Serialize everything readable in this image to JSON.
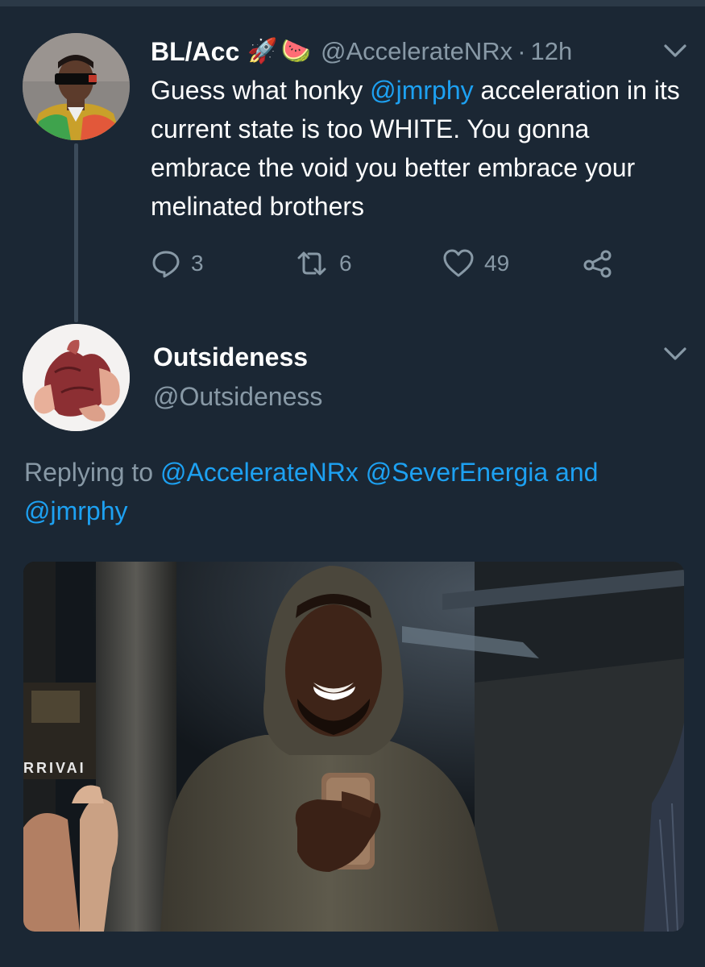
{
  "tweet": {
    "display_name": "BL/Acc",
    "emojis": [
      "🚀",
      "🍉"
    ],
    "handle": "@AccelerateNRx",
    "separator": "·",
    "time": "12h",
    "text_segments": [
      {
        "text": "Guess what honky ",
        "mention": false
      },
      {
        "text": "@jmrphy",
        "mention": true
      },
      {
        "text": " acceleration in its current state is too WHITE. You gonna embrace the void you better embrace your melinated brothers",
        "mention": false
      }
    ],
    "actions": {
      "replies": "3",
      "retweets": "6",
      "likes": "49"
    }
  },
  "reply": {
    "display_name": "Outsideness",
    "handle": "@Outsideness",
    "replying_prefix": "Replying to ",
    "replying_to": [
      "@AccelerateNRx",
      "@SeverEnergia"
    ],
    "conjunction": " and ",
    "replying_last": "@jmrphy",
    "media_sign_text": "RRIVAI"
  },
  "colors": {
    "background": "#1b2734",
    "mention": "#1da1f2",
    "secondary_text": "#8899a6"
  },
  "icons": [
    "chevron-down-icon",
    "reply-icon",
    "retweet-icon",
    "like-icon",
    "share-icon"
  ]
}
